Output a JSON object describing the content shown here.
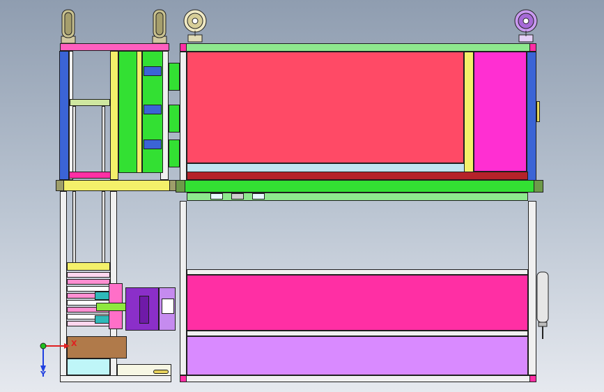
{
  "viewport": {
    "name": "cad-3d-viewport",
    "view": "front"
  },
  "triad": {
    "x_label": "X",
    "y_label": "Y"
  },
  "colors": {
    "red_panel": "#ff4a66",
    "magenta_panel": "#ff2fa4",
    "lilac_panel": "#d98aff",
    "green_plate": "#33e033",
    "light_green": "#8ee88e",
    "frame_white": "#f0f0f0",
    "frame_blue": "#3b64d6",
    "yellow": "#f4f06a",
    "purple_block": "#8b2fc9",
    "brown_block": "#b07a4a",
    "cyan_base": "#bff6f8",
    "dark_red_strip": "#b5222a"
  },
  "icons": [
    "caster-wheel-icon",
    "pneumatic-cylinder-icon",
    "axis-triad-icon"
  ]
}
